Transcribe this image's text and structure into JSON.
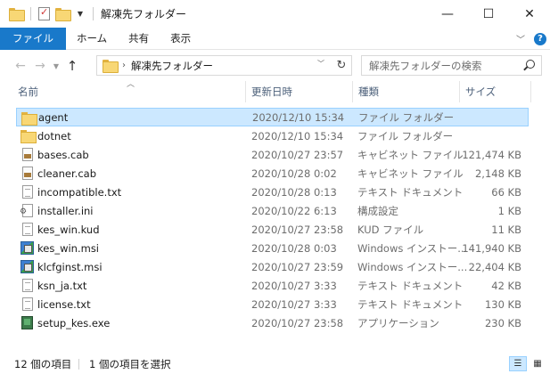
{
  "window": {
    "title": "解凍先フォルダー",
    "controls": {
      "minimize": "—",
      "maximize": "☐",
      "close": "✕"
    }
  },
  "ribbon": {
    "tabs": [
      "ファイル",
      "ホーム",
      "共有",
      "表示"
    ],
    "help_label": "?"
  },
  "address": {
    "path": "解凍先フォルダー",
    "search_placeholder": "解凍先フォルダーの検索"
  },
  "columns": {
    "name": "名前",
    "date": "更新日時",
    "type": "種類",
    "size": "サイズ"
  },
  "files": [
    {
      "name": "agent",
      "date": "2020/12/10 15:34",
      "type": "ファイル フォルダー",
      "size": "",
      "icon": "folder-icon",
      "selected": true
    },
    {
      "name": "dotnet",
      "date": "2020/12/10 15:34",
      "type": "ファイル フォルダー",
      "size": "",
      "icon": "folder-icon"
    },
    {
      "name": "bases.cab",
      "date": "2020/10/27 23:57",
      "type": "キャビネット ファイル",
      "size": "121,474 KB",
      "icon": "cabinet-file-icon"
    },
    {
      "name": "cleaner.cab",
      "date": "2020/10/28 0:02",
      "type": "キャビネット ファイル",
      "size": "2,148 KB",
      "icon": "cabinet-file-icon"
    },
    {
      "name": "incompatible.txt",
      "date": "2020/10/28 0:13",
      "type": "テキスト ドキュメント",
      "size": "66 KB",
      "icon": "text-document-icon"
    },
    {
      "name": "installer.ini",
      "date": "2020/10/22 6:13",
      "type": "構成設定",
      "size": "1 KB",
      "icon": "settings-file-icon"
    },
    {
      "name": "kes_win.kud",
      "date": "2020/10/27 23:58",
      "type": "KUD ファイル",
      "size": "11 KB",
      "icon": "generic-file-icon"
    },
    {
      "name": "kes_win.msi",
      "date": "2020/10/28 0:03",
      "type": "Windows インストー...",
      "size": "141,940 KB",
      "icon": "windows-installer-icon"
    },
    {
      "name": "klcfginst.msi",
      "date": "2020/10/27 23:59",
      "type": "Windows インストー...",
      "size": "22,404 KB",
      "icon": "windows-installer-icon"
    },
    {
      "name": "ksn_ja.txt",
      "date": "2020/10/27 3:33",
      "type": "テキスト ドキュメント",
      "size": "42 KB",
      "icon": "text-document-icon"
    },
    {
      "name": "license.txt",
      "date": "2020/10/27 3:33",
      "type": "テキスト ドキュメント",
      "size": "130 KB",
      "icon": "text-document-icon"
    },
    {
      "name": "setup_kes.exe",
      "date": "2020/10/27 23:58",
      "type": "アプリケーション",
      "size": "230 KB",
      "icon": "application-icon"
    }
  ],
  "status": {
    "item_count": "12 個の項目",
    "selected_count": "1 個の項目を選択"
  }
}
